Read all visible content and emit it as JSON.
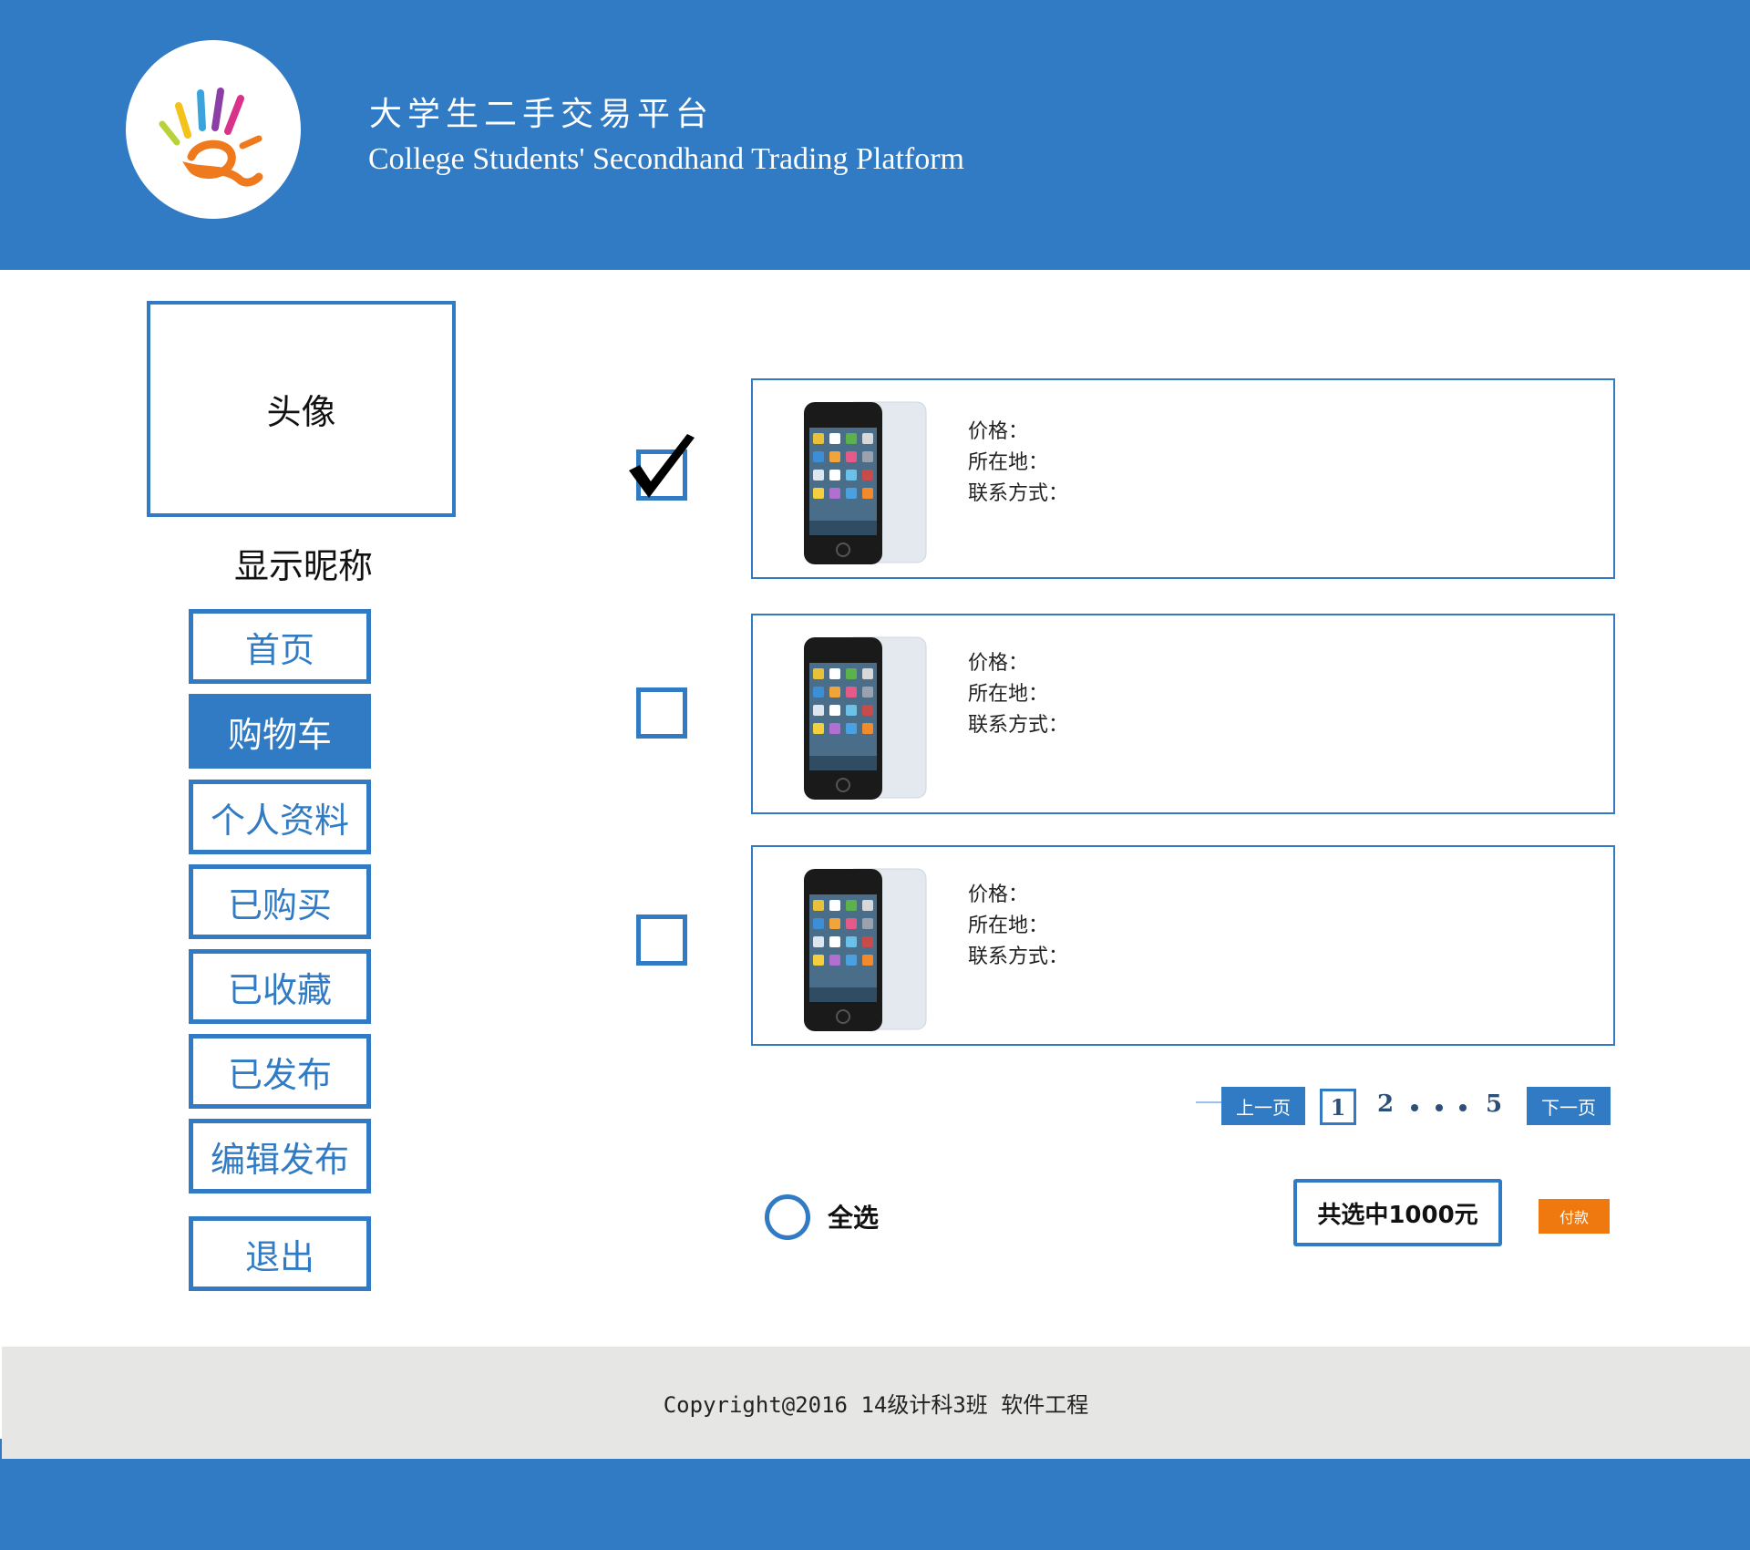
{
  "header": {
    "title_cn": "大学生二手交易平台",
    "title_en": "College Students' Secondhand Trading Platform",
    "logo_icon": "hand-logo-icon"
  },
  "sidebar": {
    "avatar_label": "头像",
    "nickname": "显示昵称",
    "nav": [
      {
        "label": "首页",
        "active": false
      },
      {
        "label": "购物车",
        "active": true
      },
      {
        "label": "个人资料",
        "active": false
      },
      {
        "label": "已购买",
        "active": false
      },
      {
        "label": "已收藏",
        "active": false
      },
      {
        "label": "已发布",
        "active": false
      },
      {
        "label": "编辑发布",
        "active": false
      },
      {
        "label": "退出",
        "active": false
      }
    ]
  },
  "cart": {
    "items": [
      {
        "checked": true,
        "price_label": "价格：",
        "location_label": "所在地：",
        "contact_label": "联系方式："
      },
      {
        "checked": false,
        "price_label": "价格：",
        "location_label": "所在地：",
        "contact_label": "联系方式："
      },
      {
        "checked": false,
        "price_label": "价格：",
        "location_label": "所在地：",
        "contact_label": "联系方式："
      }
    ]
  },
  "pagination": {
    "prev_label": "上一页",
    "current": "1",
    "page_2": "2",
    "last": "5",
    "next_label": "下一页"
  },
  "actions": {
    "select_all_label": "全选",
    "total_label": "共选中1000元",
    "pay_label": "付款"
  },
  "footer": {
    "text": "Copyright@2016   14级计科3班   软件工程"
  },
  "colors": {
    "primary": "#307bc3",
    "pay": "#f0790f",
    "footer_bg": "#e6e6e4"
  }
}
